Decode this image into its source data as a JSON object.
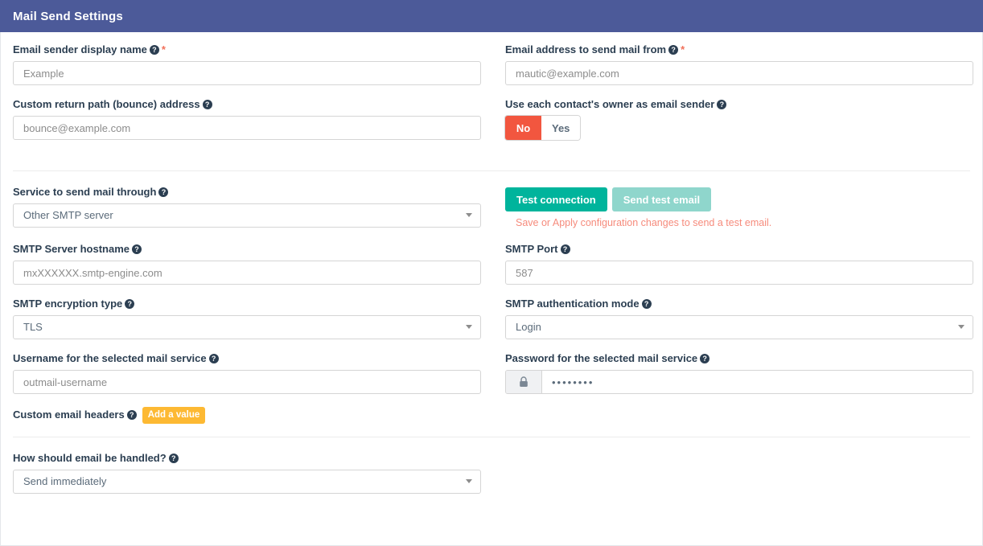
{
  "panel": {
    "title": "Mail Send Settings"
  },
  "fields": {
    "sender_name": {
      "label": "Email sender display name",
      "required": true,
      "value": "Example",
      "placeholder": "Example"
    },
    "from_address": {
      "label": "Email address to send mail from",
      "required": true,
      "value": "mautic@example.com",
      "placeholder": "mautic@example.com"
    },
    "return_path": {
      "label": "Custom return path (bounce) address",
      "value": "bounce@example.com",
      "placeholder": "bounce@example.com"
    },
    "owner_as_mailer": {
      "label": "Use each contact's owner as email sender",
      "options": [
        "No",
        "Yes"
      ],
      "selected": "No"
    },
    "mail_service": {
      "label": "Service to send mail through",
      "selected": "Other SMTP server"
    },
    "smtp_host": {
      "label": "SMTP Server hostname",
      "value": "mxXXXXXX.smtp-engine.com",
      "placeholder": "mxXXXXXX.smtp-engine.com"
    },
    "smtp_port": {
      "label": "SMTP Port",
      "value": "587",
      "placeholder": "587"
    },
    "smtp_encryption": {
      "label": "SMTP encryption type",
      "selected": "TLS"
    },
    "smtp_auth_mode": {
      "label": "SMTP authentication mode",
      "selected": "Login"
    },
    "smtp_username": {
      "label": "Username for the selected mail service",
      "value": "outmail-username",
      "placeholder": "outmail-username"
    },
    "smtp_password": {
      "label": "Password for the selected mail service",
      "value": "••••••••",
      "icon": "lock-icon"
    },
    "custom_headers": {
      "label": "Custom email headers",
      "add_button": "Add a value"
    },
    "mail_handling": {
      "label": "How should email be handled?",
      "selected": "Send immediately"
    }
  },
  "actions": {
    "test_connection": "Test connection",
    "send_test_email": "Send test email",
    "test_note": "Save or Apply configuration changes to send a test email."
  },
  "icons": {
    "help": "?",
    "caret": "caret-down-icon"
  },
  "colors": {
    "header_bg": "#4c5a99",
    "toggle_active": "#f2563f",
    "primary_button": "#00b49c",
    "disabled_button": "#8fd6cc",
    "badge": "#fdb933",
    "note_text": "#f68b7c",
    "label_text": "#2b3e51"
  }
}
